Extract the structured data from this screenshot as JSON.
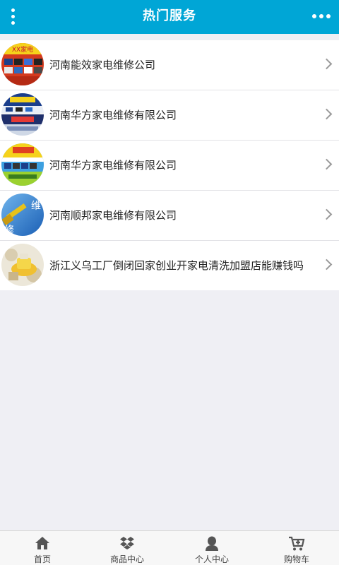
{
  "header": {
    "title": "热门服务",
    "menu_icon": "vertical-dots-icon",
    "more_icon": "horizontal-dots-icon",
    "color": "#00a6d6"
  },
  "list": {
    "items": [
      {
        "label": "河南能效家电维修公司",
        "thumb": "appliance-repair-storefront-image"
      },
      {
        "label": "河南华方家电维修有限公司",
        "thumb": "repair-shop-banner-image"
      },
      {
        "label": "河南华方家电维修有限公司",
        "thumb": "repair-shop-banner-image"
      },
      {
        "label": "河南顺邦家电维修有限公司",
        "thumb": "hammer-repair-image",
        "thumb_text": [
          "维",
          "修"
        ]
      },
      {
        "label": "浙江义乌工厂倒闭回家创业开家电清洗加盟店能赚钱吗",
        "thumb": "cleaning-product-image"
      }
    ]
  },
  "tabbar": {
    "tabs": [
      {
        "label": "首页",
        "icon": "home-icon"
      },
      {
        "label": "商品中心",
        "icon": "dropbox-icon"
      },
      {
        "label": "个人中心",
        "icon": "user-icon"
      },
      {
        "label": "购物车",
        "icon": "cart-icon"
      }
    ]
  }
}
